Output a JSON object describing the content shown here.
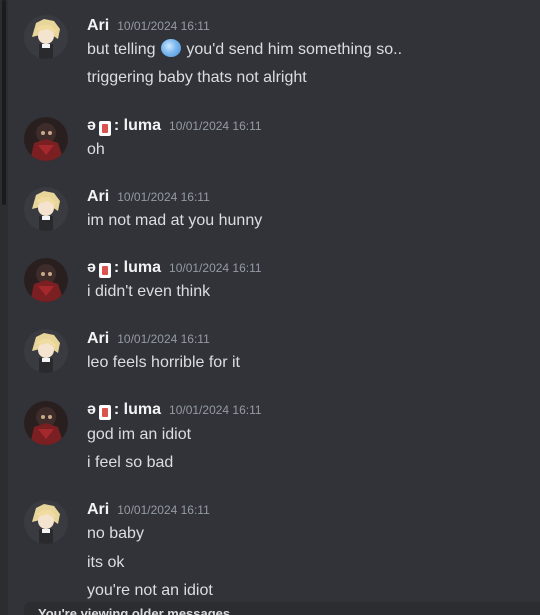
{
  "messages": [
    {
      "author": "Ari",
      "timestamp": "10/01/2024 16:11",
      "avatar_icon": "anime-blonde-boy-avatar",
      "lines": [
        "but telling",
        "you'd send him something so..",
        "triggering baby thats not alright"
      ],
      "inline_emoji": "blue-orb-emoji"
    },
    {
      "author_prefix": "ə",
      "author_icon": "playing-card-icon",
      "author": ": luma",
      "timestamp": "10/01/2024 16:11",
      "avatar_icon": "dark-red-character-avatar",
      "lines": [
        "oh"
      ]
    },
    {
      "author": "Ari",
      "timestamp": "10/01/2024 16:11",
      "avatar_icon": "anime-blonde-boy-avatar",
      "lines": [
        "im not mad at you hunny"
      ]
    },
    {
      "author_prefix": "ə",
      "author_icon": "playing-card-icon",
      "author": ": luma",
      "timestamp": "10/01/2024 16:11",
      "avatar_icon": "dark-red-character-avatar",
      "lines": [
        "i didn't even think"
      ]
    },
    {
      "author": "Ari",
      "timestamp": "10/01/2024 16:11",
      "avatar_icon": "anime-blonde-boy-avatar",
      "lines": [
        "leo feels horrible for it"
      ]
    },
    {
      "author_prefix": "ə",
      "author_icon": "playing-card-icon",
      "author": ": luma",
      "timestamp": "10/01/2024 16:11",
      "avatar_icon": "dark-red-character-avatar",
      "lines": [
        "god im an idiot",
        "i feel so bad"
      ]
    },
    {
      "author": "Ari",
      "timestamp": "10/01/2024 16:11",
      "avatar_icon": "anime-blonde-boy-avatar",
      "lines": [
        "no baby",
        "its ok",
        "you're not an idiot"
      ]
    }
  ],
  "footer": {
    "notice": "You're viewing older messages"
  },
  "colors": {
    "background": "#323339",
    "author": "#f2f3f5",
    "timestamp": "#949ba4",
    "text": "#dbdee1"
  }
}
